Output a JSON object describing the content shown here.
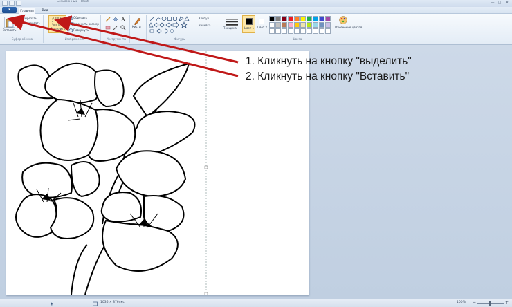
{
  "window": {
    "title": "Безымянный - Paint",
    "controls": [
      "—",
      "□",
      "✕"
    ]
  },
  "menu_button": {
    "icon": "paint-menu-icon",
    "label": "▾"
  },
  "tabs": [
    {
      "label": "Главная",
      "active": true
    },
    {
      "label": "Вид",
      "active": false
    }
  ],
  "ribbon": {
    "clipboard": {
      "paste_label": "Вставить",
      "cut_label": "Вырезать",
      "copy_label": "Копировать",
      "group_label": "Буфер обмена"
    },
    "image": {
      "select_label": "Выделить",
      "crop_label": "Обрезать",
      "resize_label": "Изменить размер",
      "rotate_label": "Повернуть",
      "group_label": "Изображение"
    },
    "tools": {
      "group_label": "Инструменты"
    },
    "brushes": {
      "label": "Кисти"
    },
    "shapes": {
      "contour_label": "Контур",
      "fill_label": "Заливка",
      "group_label": "Фигуры"
    },
    "size": {
      "label": "Толщина"
    },
    "colors": {
      "color1_label": "Цвет 1",
      "color2_label": "Цвет 2",
      "edit_label": "Изменение цветов",
      "group_label": "Цвета",
      "color1": "#000000",
      "color2": "#ffffff",
      "palette": [
        "#000000",
        "#7f7f7f",
        "#880015",
        "#ed1c24",
        "#ff7f27",
        "#fff200",
        "#22b14c",
        "#00a2e8",
        "#3f48cc",
        "#a349a4",
        "#ffffff",
        "#c3c3c3",
        "#b97a57",
        "#ffaec9",
        "#ffc90e",
        "#efe4b0",
        "#b5e61d",
        "#99d9ea",
        "#7092be",
        "#c8bfe7"
      ]
    }
  },
  "annotations": {
    "step1": "1. Кликнуть на кнопку \"выделить\"",
    "step2": "2. Кликнуть на кнопку \"Вставить\"",
    "arrow_color": "#c01818"
  },
  "statusbar": {
    "image_size": "1036 × 876пкс",
    "zoom": "100%"
  }
}
